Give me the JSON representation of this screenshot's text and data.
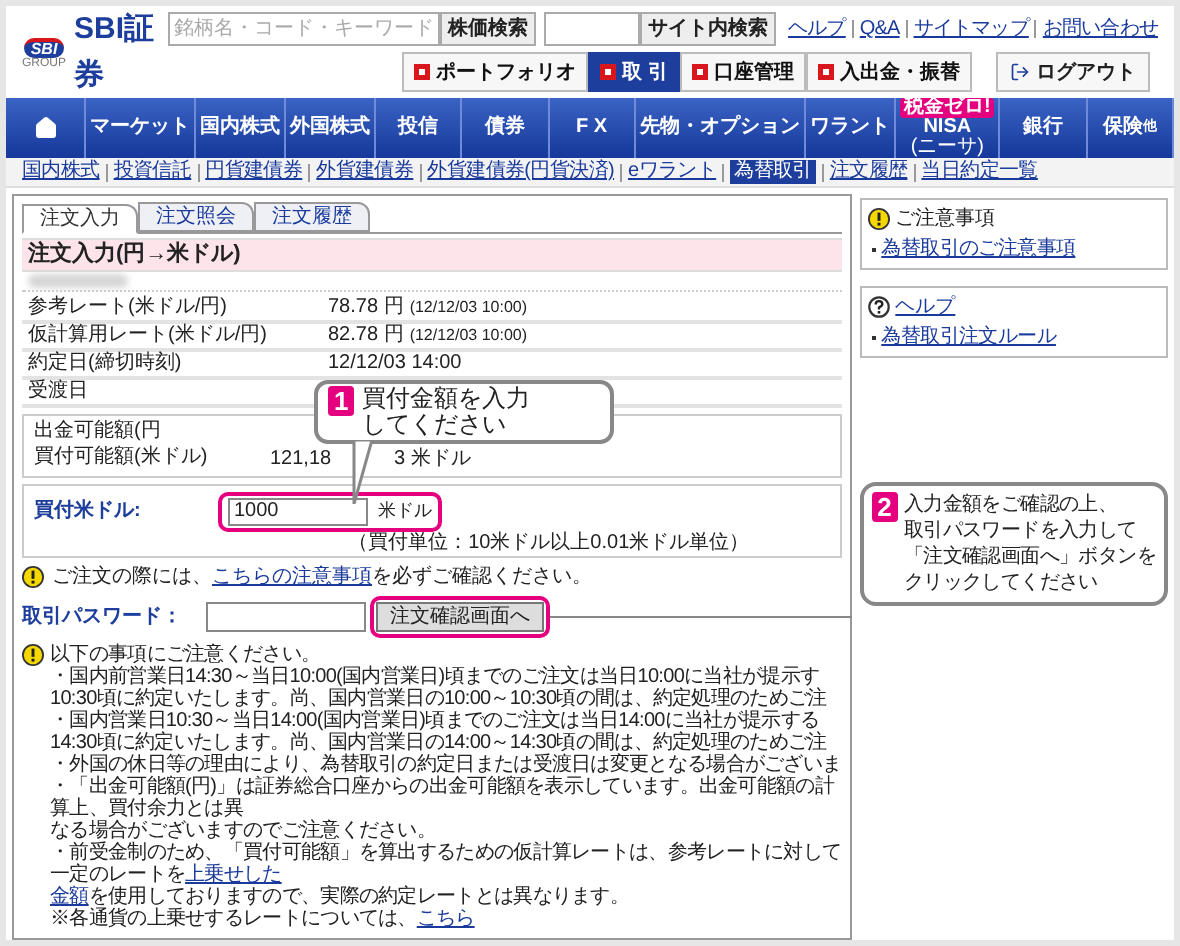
{
  "header": {
    "logo": {
      "mark": "SBI",
      "sub": "GROUP",
      "name": "SBI証券"
    },
    "search": {
      "placeholder": "銘柄名・コード・キーワード",
      "button": "株価検索"
    },
    "site_search": {
      "button": "サイト内検索"
    },
    "links": [
      "ヘルプ",
      "Q&A",
      "サイトマップ",
      "お問い合わせ"
    ],
    "buttons": [
      {
        "label": "ポートフォリオ",
        "selected": false
      },
      {
        "label": "取 引",
        "selected": true
      },
      {
        "label": "口座管理",
        "selected": false
      },
      {
        "label": "入出金・振替",
        "selected": false
      }
    ],
    "logout": "ログアウト"
  },
  "nav": [
    {
      "kind": "home"
    },
    {
      "kind": "text",
      "label": "マーケット"
    },
    {
      "kind": "text",
      "label": "国内株式"
    },
    {
      "kind": "text",
      "label": "外国株式"
    },
    {
      "kind": "text",
      "label": "投信"
    },
    {
      "kind": "text",
      "label": "債券"
    },
    {
      "kind": "text",
      "label": "F X"
    },
    {
      "kind": "text",
      "label": "先物・オプション"
    },
    {
      "kind": "text",
      "label": "ワラント"
    },
    {
      "kind": "nisa",
      "label": "NISA",
      "badge": "税金ゼロ!",
      "sub": "(ニーサ)"
    },
    {
      "kind": "text",
      "label": "銀行"
    },
    {
      "kind": "text",
      "label": "保険",
      "suffix": "他"
    }
  ],
  "subnav": [
    {
      "label": "国内株式",
      "selected": false
    },
    {
      "label": "投資信託",
      "selected": false
    },
    {
      "label": "円貨建債券",
      "selected": false
    },
    {
      "label": "外貨建債券",
      "selected": false
    },
    {
      "label": "外貨建債券(円貨決済)",
      "selected": false
    },
    {
      "label": "eワラント",
      "selected": false
    },
    {
      "label": "為替取引",
      "selected": true
    },
    {
      "label": "注文履歴",
      "selected": false
    },
    {
      "label": "当日約定一覧",
      "selected": false
    }
  ],
  "tabs": [
    {
      "label": "注文入力",
      "selected": true
    },
    {
      "label": "注文照会",
      "selected": false
    },
    {
      "label": "注文履歴",
      "selected": false
    }
  ],
  "order": {
    "title": "注文入力(円→米ドル)",
    "rates": [
      {
        "label": "参考レート(米ドル/円)",
        "value": "78.78 円",
        "time": "(12/12/03 10:00)"
      },
      {
        "label": "仮計算用レート(米ドル/円)",
        "value": "82.78 円",
        "time": "(12/12/03 10:00)"
      },
      {
        "label": "約定日(締切時刻)",
        "value": "12/12/03 14:00"
      },
      {
        "label": "受渡日"
      }
    ],
    "available": [
      {
        "label": "出金可能額(円"
      },
      {
        "label": "買付可能額(米ドル)",
        "value": "121,18",
        "value_end": "3 米ドル"
      }
    ],
    "buy": {
      "label": "買付米ドル:",
      "value": "1000",
      "unit": "米ドル",
      "note": "（買付単位：10米ドル以上0.01米ドル単位）"
    },
    "caution": {
      "before": "ご注文の際には、",
      "link": "こちらの注意事項",
      "after": "を必ずご確認ください。"
    },
    "password": {
      "label": "取引パスワード：",
      "button": "注文確認画面へ"
    },
    "notes": {
      "heading": "以下の事項にご注意ください。",
      "lines": [
        {
          "parts": [
            {
              "kind": "text",
              "text": "・国内前営業日14:30～当日10:00(国内営業日)頃までのご注文は当日10:00に当社が提示す"
            }
          ]
        },
        {
          "parts": [
            {
              "kind": "text",
              "text": "10:30頃に約定いたします。尚、国内営業日の10:00～10:30頃の間は、約定処理のためご注"
            }
          ]
        },
        {
          "parts": [
            {
              "kind": "text",
              "text": "・国内営業日10:30～当日14:00(国内営業日)頃までのご注文は当日14:00に当社が提示する"
            }
          ]
        },
        {
          "parts": [
            {
              "kind": "text",
              "text": "14:30頃に約定いたします。尚、国内営業日の14:00～14:30頃の間は、約定処理のためご注"
            }
          ]
        },
        {
          "parts": [
            {
              "kind": "text",
              "text": "・外国の休日等の理由により、為替取引の約定日または受渡日は変更となる場合がございま"
            }
          ]
        },
        {
          "parts": [
            {
              "kind": "text",
              "text": "・「出金可能額(円)」は証券総合口座からの出金可能額を表示しています。出金可能額の計算上、買付余力とは異"
            }
          ]
        },
        {
          "parts": [
            {
              "kind": "text",
              "text": "なる場合がございますのでご注意ください。"
            }
          ]
        },
        {
          "parts": [
            {
              "kind": "text",
              "text": "・前受金制のため、「買付可能額」を算出するための仮計算レートは、参考レートに対して一定のレートを"
            },
            {
              "kind": "link",
              "text": "上乗せした"
            }
          ]
        },
        {
          "parts": [
            {
              "kind": "link",
              "text": "金額"
            },
            {
              "kind": "text",
              "text": "を使用しておりますので、実際の約定レートとは異なります。"
            }
          ]
        },
        {
          "parts": [
            {
              "kind": "text",
              "text": "※各通貨の上乗せするレートについては、"
            },
            {
              "kind": "link",
              "text": "こちら"
            }
          ]
        }
      ]
    }
  },
  "sidebar": [
    {
      "kind": "caution",
      "title": "ご注意事項",
      "links": [
        "為替取引のご注意事項"
      ]
    },
    {
      "kind": "help",
      "title": "ヘルプ",
      "links": [
        "為替取引注文ルール"
      ]
    }
  ],
  "callouts": [
    {
      "number": "1",
      "lines": [
        "買付金額を入力",
        "してください"
      ]
    },
    {
      "number": "2",
      "lines": [
        "入力金額をご確認の上、",
        "取引パスワードを入力して",
        "「注文確認画面へ」ボタンを",
        "クリックしてください"
      ]
    }
  ]
}
